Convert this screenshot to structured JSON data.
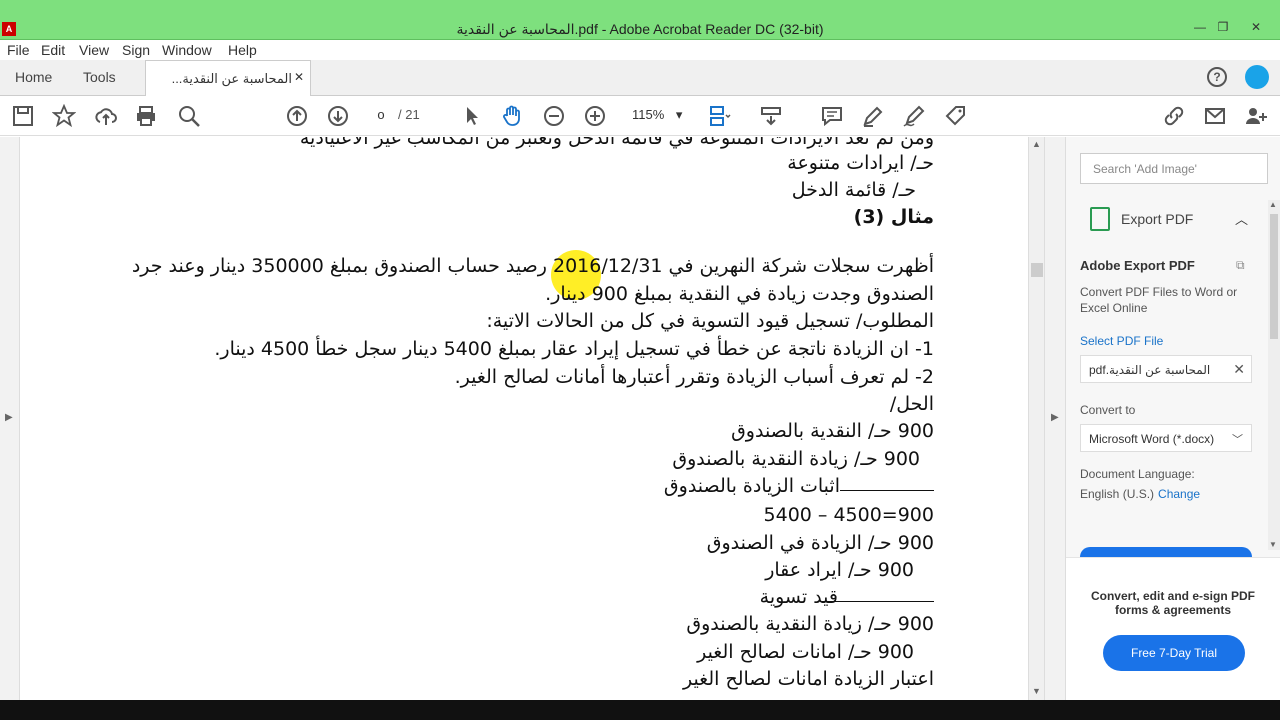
{
  "window": {
    "title": "المحاسبة عن النقدية.pdf - Adobe Acrobat Reader DC (32-bit)",
    "app_badge": "A",
    "minimize": "—",
    "restore": "❐",
    "close": "✕"
  },
  "menu": [
    "File",
    "Edit",
    "View",
    "Sign",
    "Window",
    "Help"
  ],
  "tabs": {
    "home": "Home",
    "tools": "Tools",
    "doc_tab": "المحاسبة عن النقدية...",
    "close": "✕",
    "help": "?"
  },
  "toolbar": {
    "page_current": "o",
    "page_total": "/ 21",
    "zoom": "115%",
    "zoom_caret": "▾"
  },
  "document": {
    "lines": [
      "ومن لم تعد الايرادات المتنوعة في قائمة الدخل وتعتبر من المكاسب غير الاعتيادية",
      "حـ/ ايرادات متنوعة",
      "حـ/ قائمة الدخل",
      "مثال (3)",
      "أظهرت سجلات شركة النهرين في 2016/12/31 رصيد حساب الصندوق بمبلغ 350000 دينار وعند جرد",
      "الصندوق وجدت زيادة في النقدية بمبلغ 900 دينار.",
      "المطلوب/ تسجيل قيود التسوية في كل من الحالات الاتية:",
      "1- ان الزيادة ناتجة عن خطأ في تسجيل إيراد عقار بمبلغ 5400 دينار سجل خطأ 4500 دينار.",
      "2- لم تعرف أسباب الزيادة وتقرر أعتبارها أمانات لصالح الغير.",
      "الحل/",
      "900 حـ/ النقدية بالصندوق",
      "900 حـ/ زيادة النقدية  بالصندوق",
      "اثبات الزيادة بالصندوق",
      "5400 – 4500=900",
      "900 حـ/ الزيادة في الصندوق",
      "900 حـ/ ايراد عقار",
      "قيد تسوية",
      "900 حـ/ زيادة النقدية بالصندوق",
      "900 حـ/ امانات لصالح الغير",
      "اعتبار الزيادة امانات لصالح الغير"
    ]
  },
  "right_panel": {
    "search_placeholder": "Search 'Add Image'",
    "export_label": "Export PDF",
    "ae_title": "Adobe Export PDF",
    "ae_desc": "Convert PDF Files to Word or Excel Online",
    "select_pdf": "Select PDF File",
    "file_name": "المحاسبة عن النقدية.pdf",
    "convert_to": "Convert to",
    "convert_value": "Microsoft Word (*.docx)",
    "doc_lang": "Document Language:",
    "lang_value": "English (U.S.)",
    "change": "Change",
    "promo": "Convert, edit and e-sign PDF forms & agreements",
    "trial": "Free 7-Day Trial"
  },
  "colors": {
    "titlebar": "#7ee07e",
    "accent": "#1a73e8",
    "highlight": "#ffeb00"
  }
}
